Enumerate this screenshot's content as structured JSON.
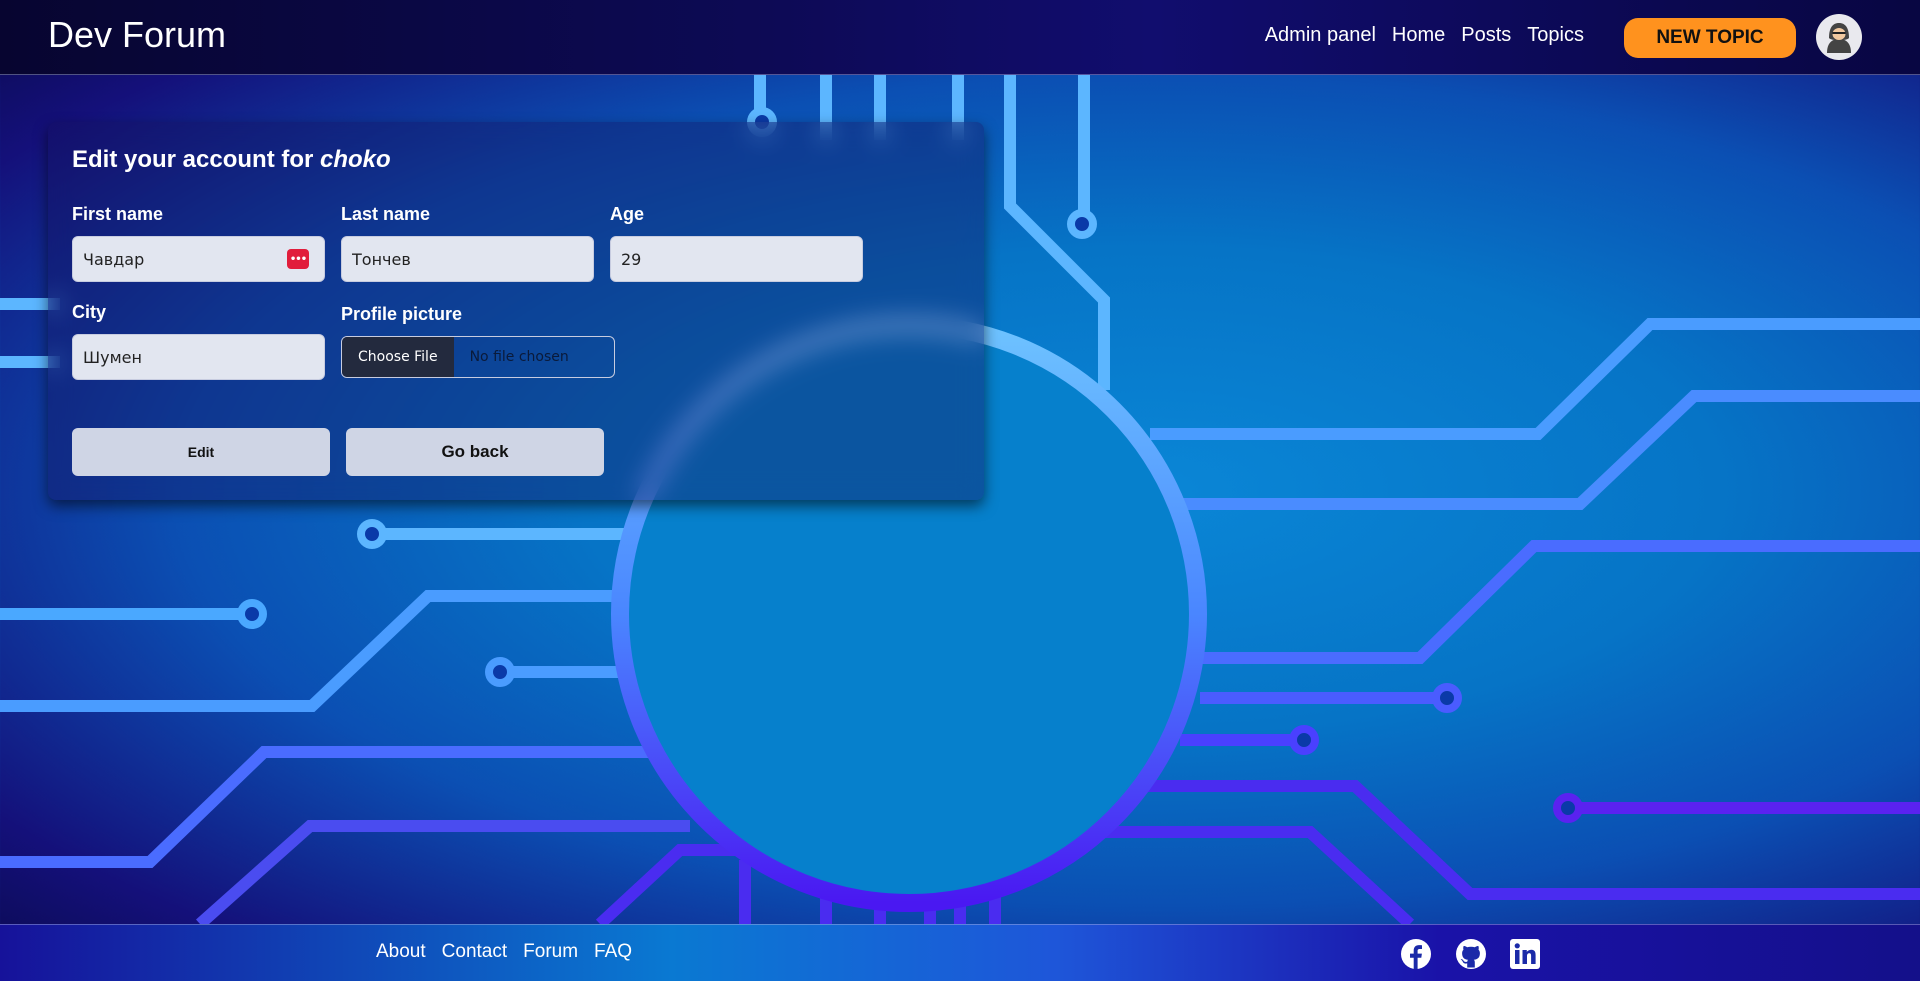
{
  "header": {
    "logo": "Dev Forum",
    "nav": [
      "Admin panel",
      "Home",
      "Posts",
      "Topics"
    ],
    "new_topic": "NEW TOPIC",
    "avatar_icon": "user-avatar-icon"
  },
  "form": {
    "title_prefix": "Edit your account for ",
    "username": "choko",
    "first_name": {
      "label": "First name",
      "value": "Чавдар"
    },
    "last_name": {
      "label": "Last name",
      "value": "Тончев"
    },
    "age": {
      "label": "Age",
      "value": "29"
    },
    "city": {
      "label": "City",
      "value": "Шумен"
    },
    "profile_picture": {
      "label": "Profile picture",
      "button": "Choose File",
      "status": "No file chosen"
    },
    "edit_button": "Edit",
    "back_button": "Go back",
    "password_manager_icon": "password-manager-icon"
  },
  "footer": {
    "nav": [
      "About",
      "Contact",
      "Forum",
      "FAQ"
    ],
    "social_icons": [
      "facebook-icon",
      "github-icon",
      "linkedin-icon"
    ]
  },
  "colors": {
    "accent": "#ff921e",
    "header_bg": "#0d0a55",
    "circuit_light": "#5cb6ff",
    "circuit_violet": "#4a2cf0"
  }
}
